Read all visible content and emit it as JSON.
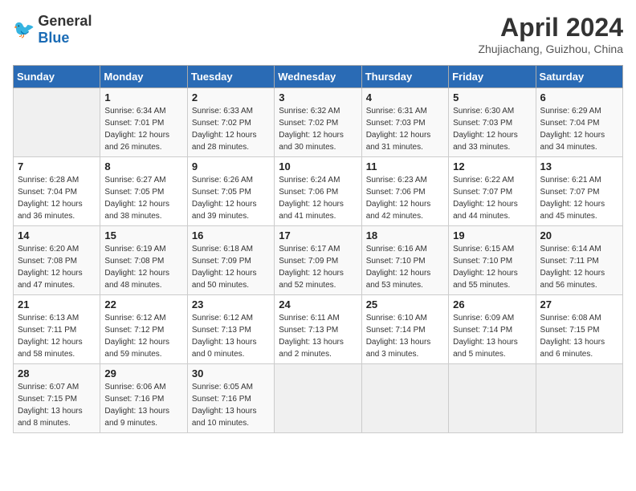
{
  "header": {
    "logo_general": "General",
    "logo_blue": "Blue",
    "title": "April 2024",
    "location": "Zhujiachang, Guizhou, China"
  },
  "weekdays": [
    "Sunday",
    "Monday",
    "Tuesday",
    "Wednesday",
    "Thursday",
    "Friday",
    "Saturday"
  ],
  "weeks": [
    [
      {
        "day": "",
        "info": ""
      },
      {
        "day": "1",
        "info": "Sunrise: 6:34 AM\nSunset: 7:01 PM\nDaylight: 12 hours\nand 26 minutes."
      },
      {
        "day": "2",
        "info": "Sunrise: 6:33 AM\nSunset: 7:02 PM\nDaylight: 12 hours\nand 28 minutes."
      },
      {
        "day": "3",
        "info": "Sunrise: 6:32 AM\nSunset: 7:02 PM\nDaylight: 12 hours\nand 30 minutes."
      },
      {
        "day": "4",
        "info": "Sunrise: 6:31 AM\nSunset: 7:03 PM\nDaylight: 12 hours\nand 31 minutes."
      },
      {
        "day": "5",
        "info": "Sunrise: 6:30 AM\nSunset: 7:03 PM\nDaylight: 12 hours\nand 33 minutes."
      },
      {
        "day": "6",
        "info": "Sunrise: 6:29 AM\nSunset: 7:04 PM\nDaylight: 12 hours\nand 34 minutes."
      }
    ],
    [
      {
        "day": "7",
        "info": "Sunrise: 6:28 AM\nSunset: 7:04 PM\nDaylight: 12 hours\nand 36 minutes."
      },
      {
        "day": "8",
        "info": "Sunrise: 6:27 AM\nSunset: 7:05 PM\nDaylight: 12 hours\nand 38 minutes."
      },
      {
        "day": "9",
        "info": "Sunrise: 6:26 AM\nSunset: 7:05 PM\nDaylight: 12 hours\nand 39 minutes."
      },
      {
        "day": "10",
        "info": "Sunrise: 6:24 AM\nSunset: 7:06 PM\nDaylight: 12 hours\nand 41 minutes."
      },
      {
        "day": "11",
        "info": "Sunrise: 6:23 AM\nSunset: 7:06 PM\nDaylight: 12 hours\nand 42 minutes."
      },
      {
        "day": "12",
        "info": "Sunrise: 6:22 AM\nSunset: 7:07 PM\nDaylight: 12 hours\nand 44 minutes."
      },
      {
        "day": "13",
        "info": "Sunrise: 6:21 AM\nSunset: 7:07 PM\nDaylight: 12 hours\nand 45 minutes."
      }
    ],
    [
      {
        "day": "14",
        "info": "Sunrise: 6:20 AM\nSunset: 7:08 PM\nDaylight: 12 hours\nand 47 minutes."
      },
      {
        "day": "15",
        "info": "Sunrise: 6:19 AM\nSunset: 7:08 PM\nDaylight: 12 hours\nand 48 minutes."
      },
      {
        "day": "16",
        "info": "Sunrise: 6:18 AM\nSunset: 7:09 PM\nDaylight: 12 hours\nand 50 minutes."
      },
      {
        "day": "17",
        "info": "Sunrise: 6:17 AM\nSunset: 7:09 PM\nDaylight: 12 hours\nand 52 minutes."
      },
      {
        "day": "18",
        "info": "Sunrise: 6:16 AM\nSunset: 7:10 PM\nDaylight: 12 hours\nand 53 minutes."
      },
      {
        "day": "19",
        "info": "Sunrise: 6:15 AM\nSunset: 7:10 PM\nDaylight: 12 hours\nand 55 minutes."
      },
      {
        "day": "20",
        "info": "Sunrise: 6:14 AM\nSunset: 7:11 PM\nDaylight: 12 hours\nand 56 minutes."
      }
    ],
    [
      {
        "day": "21",
        "info": "Sunrise: 6:13 AM\nSunset: 7:11 PM\nDaylight: 12 hours\nand 58 minutes."
      },
      {
        "day": "22",
        "info": "Sunrise: 6:12 AM\nSunset: 7:12 PM\nDaylight: 12 hours\nand 59 minutes."
      },
      {
        "day": "23",
        "info": "Sunrise: 6:12 AM\nSunset: 7:13 PM\nDaylight: 13 hours\nand 0 minutes."
      },
      {
        "day": "24",
        "info": "Sunrise: 6:11 AM\nSunset: 7:13 PM\nDaylight: 13 hours\nand 2 minutes."
      },
      {
        "day": "25",
        "info": "Sunrise: 6:10 AM\nSunset: 7:14 PM\nDaylight: 13 hours\nand 3 minutes."
      },
      {
        "day": "26",
        "info": "Sunrise: 6:09 AM\nSunset: 7:14 PM\nDaylight: 13 hours\nand 5 minutes."
      },
      {
        "day": "27",
        "info": "Sunrise: 6:08 AM\nSunset: 7:15 PM\nDaylight: 13 hours\nand 6 minutes."
      }
    ],
    [
      {
        "day": "28",
        "info": "Sunrise: 6:07 AM\nSunset: 7:15 PM\nDaylight: 13 hours\nand 8 minutes."
      },
      {
        "day": "29",
        "info": "Sunrise: 6:06 AM\nSunset: 7:16 PM\nDaylight: 13 hours\nand 9 minutes."
      },
      {
        "day": "30",
        "info": "Sunrise: 6:05 AM\nSunset: 7:16 PM\nDaylight: 13 hours\nand 10 minutes."
      },
      {
        "day": "",
        "info": ""
      },
      {
        "day": "",
        "info": ""
      },
      {
        "day": "",
        "info": ""
      },
      {
        "day": "",
        "info": ""
      }
    ]
  ]
}
